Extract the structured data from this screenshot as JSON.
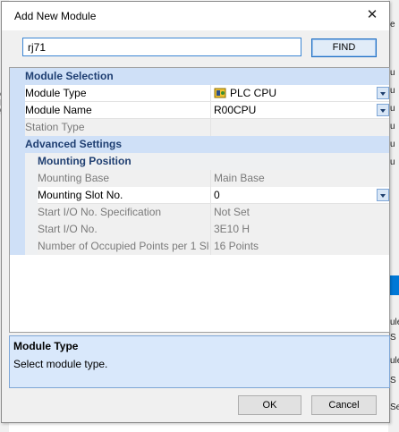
{
  "background": {
    "left_fragments": [
      "P",
      "es",
      "g"
    ],
    "right_fragments": [
      "e",
      "u",
      "u",
      "u",
      "u",
      "u",
      "u",
      "ule",
      "S",
      "ule",
      "S",
      "Se"
    ]
  },
  "dialog": {
    "title": "Add New Module",
    "close_icon": "close-icon"
  },
  "search": {
    "value": "rj71",
    "button_label": "FIND"
  },
  "grid": {
    "module_selection": {
      "label": "Module Selection",
      "module_type": {
        "label": "Module Type",
        "value": "PLC CPU",
        "icon": "plc-cpu-icon"
      },
      "module_name": {
        "label": "Module Name",
        "value": "R00CPU"
      },
      "station_type": {
        "label": "Station Type",
        "value": ""
      }
    },
    "advanced_settings": {
      "label": "Advanced Settings",
      "mounting_position": {
        "label": "Mounting Position",
        "mounting_base": {
          "label": "Mounting Base",
          "value": "Main Base"
        },
        "mounting_slot": {
          "label": "Mounting Slot No.",
          "value": "0"
        },
        "start_io_spec": {
          "label": "Start I/O No. Specification",
          "value": "Not Set"
        },
        "start_io": {
          "label": "Start I/O No.",
          "value": "3E10 H"
        },
        "occupied_points": {
          "label": "Number of Occupied Points per 1 Slot",
          "value": "16 Points"
        }
      }
    }
  },
  "description": {
    "title": "Module Type",
    "text": "Select module type."
  },
  "buttons": {
    "ok": "OK",
    "cancel": "Cancel"
  },
  "colors": {
    "category_bg": "#cfe0f7",
    "accent": "#1e6ec2",
    "description_bg": "#d9e8fb"
  }
}
